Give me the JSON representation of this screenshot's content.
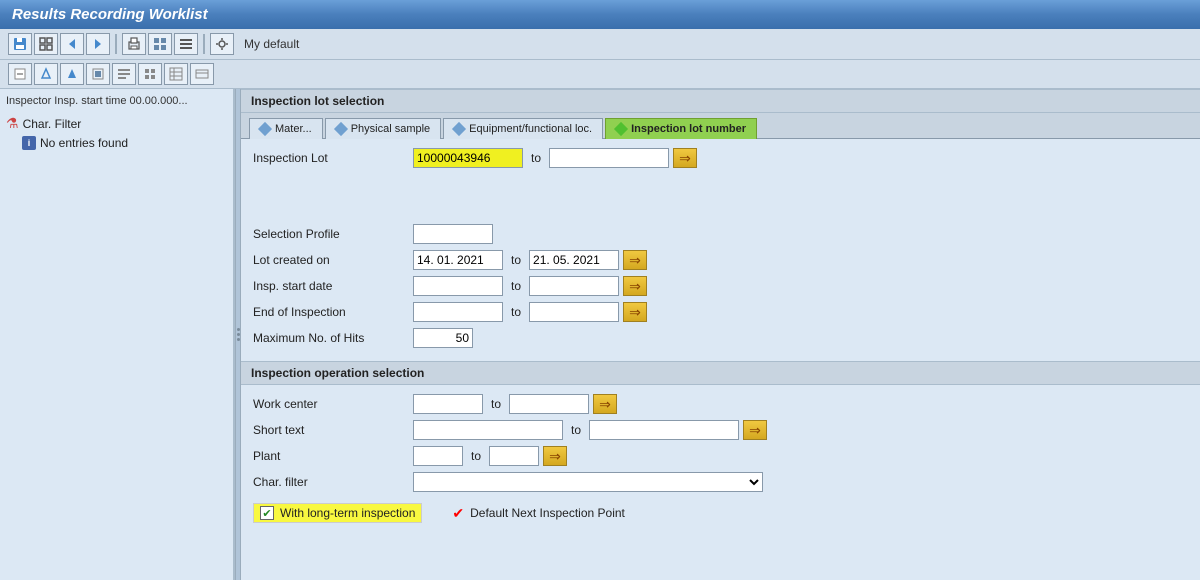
{
  "titleBar": {
    "title": "Results Recording Worklist"
  },
  "toolbar": {
    "label": "My default",
    "buttons": [
      "save",
      "back",
      "forward",
      "refresh",
      "print",
      "grid",
      "settings"
    ]
  },
  "secondToolbar": {
    "buttons": [
      "btn1",
      "btn2",
      "btn3",
      "btn4",
      "btn5",
      "btn6",
      "btn7",
      "btn8"
    ]
  },
  "leftPanel": {
    "title": "Inspector Insp. start time 00.00.000...",
    "treeItems": [
      {
        "label": "Char. Filter",
        "type": "filter"
      },
      {
        "label": "No entries found",
        "type": "info"
      }
    ]
  },
  "rightPanel": {
    "sectionTitle": "Inspection lot selection",
    "tabs": [
      {
        "id": "mater",
        "label": "Mater...",
        "active": false
      },
      {
        "id": "physical",
        "label": "Physical sample",
        "active": false
      },
      {
        "id": "equipment",
        "label": "Equipment/functional loc.",
        "active": false
      },
      {
        "id": "inspection",
        "label": "Inspection lot number",
        "active": true
      }
    ],
    "form": {
      "inspectionLotLabel": "Inspection Lot",
      "inspectionLotValue": "10000043946",
      "inspectionLotTo": "",
      "selectionProfileLabel": "Selection Profile",
      "selectionProfileValue": "",
      "lotCreatedOnLabel": "Lot created on",
      "lotCreatedOnValue": "14. 01. 2021",
      "lotCreatedOnTo": "21. 05. 2021",
      "inspStartDateLabel": "Insp. start date",
      "inspStartDateValue": "",
      "inspStartDateTo": "",
      "endOfInspectionLabel": "End of Inspection",
      "endOfInspectionValue": "",
      "endOfInspectionTo": "",
      "maxHitsLabel": "Maximum No. of Hits",
      "maxHitsValue": "50"
    },
    "opSection": {
      "title": "Inspection operation selection",
      "workCenterLabel": "Work center",
      "workCenterValue": "",
      "workCenterTo": "",
      "shortTextLabel": "Short text",
      "shortTextValue": "",
      "shortTextTo": "",
      "plantLabel": "Plant",
      "plantValue": "",
      "plantTo": "",
      "charFilterLabel": "Char. filter",
      "charFilterValue": "",
      "withLongTermLabel": "With long-term inspection",
      "defaultNextLabel": "Default Next Inspection Point"
    }
  }
}
